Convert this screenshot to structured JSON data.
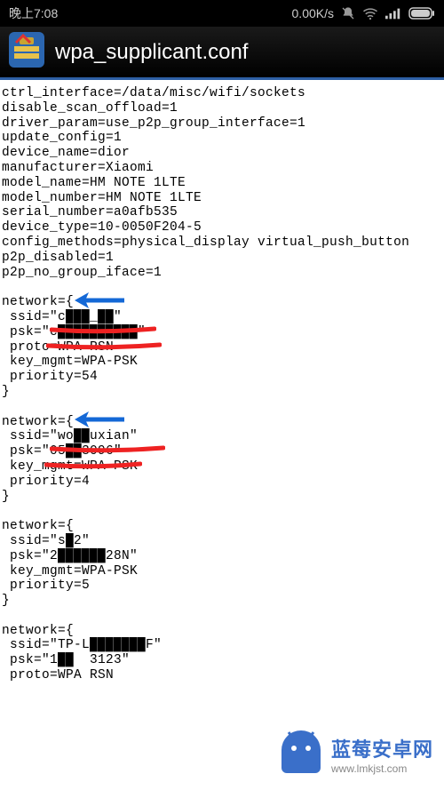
{
  "status": {
    "time": "晚上7:08",
    "netspeed": "0.00K/s"
  },
  "appbar": {
    "title": "wpa_supplicant.conf"
  },
  "file": {
    "lines": [
      "ctrl_interface=/data/misc/wifi/sockets",
      "disable_scan_offload=1",
      "driver_param=use_p2p_group_interface=1",
      "update_config=1",
      "device_name=dior",
      "manufacturer=Xiaomi",
      "model_name=HM NOTE 1LTE",
      "model_number=HM NOTE 1LTE",
      "serial_number=a0afb535",
      "device_type=10-0050F204-5",
      "config_methods=physical_display virtual_push_button",
      "p2p_disabled=1",
      "p2p_no_group_iface=1",
      "",
      "network={",
      " ssid=\"c███_██\"",
      " psk=\"c██████████\"",
      " proto=WPA RSN",
      " key_mgmt=WPA-PSK",
      " priority=54",
      "}",
      "",
      "network={",
      " ssid=\"wo██uxian\"",
      " psk=\"05██3096\"",
      " key_mgmt=WPA-PSK",
      " priority=4",
      "}",
      "",
      "network={",
      " ssid=\"s█2\"",
      " psk=\"2██████28N\"",
      " key_mgmt=WPA-PSK",
      " priority=5",
      "}",
      "",
      "network={",
      " ssid=\"TP-L███████F\"",
      " psk=\"1██  3123\"",
      " proto=WPA RSN"
    ]
  },
  "watermark": {
    "cn": "蓝莓安卓网",
    "url": "www.lmkjst.com"
  }
}
